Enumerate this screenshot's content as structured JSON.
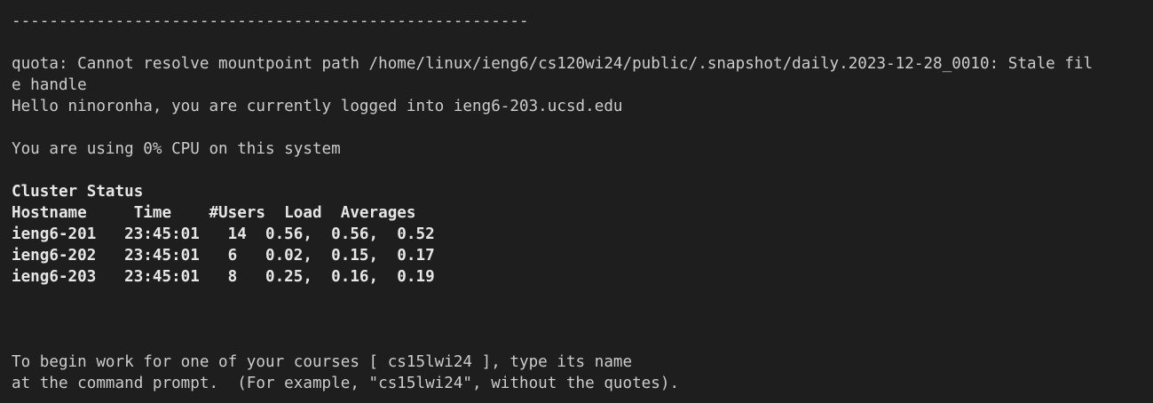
{
  "terminal": {
    "separator": "-------------------------------------------------------",
    "quota_line_1": "quota: Cannot resolve mountpoint path /home/linux/ieng6/cs120wi24/public/.snapshot/daily.2023-12-28_0010: Stale fil",
    "quota_line_2": "e handle",
    "hello_line": "Hello ninoronha, you are currently logged into ieng6-203.ucsd.edu",
    "cpu_line": "You are using 0% CPU on this system",
    "cluster_title": "Cluster Status",
    "cluster_header": "Hostname     Time    #Users  Load  Averages",
    "cluster_rows": [
      "ieng6-201   23:45:01   14  0.56,  0.56,  0.52",
      "ieng6-202   23:45:01   6   0.02,  0.15,  0.17",
      "ieng6-203   23:45:01   8   0.25,  0.16,  0.19"
    ],
    "course_line_1": "To begin work for one of your courses [ cs15lwi24 ], type its name",
    "course_line_2": "at the command prompt.  (For example, \"cs15lwi24\", without the quotes)."
  },
  "colors": {
    "background": "#1e1e1e",
    "text": "#cccccc"
  }
}
